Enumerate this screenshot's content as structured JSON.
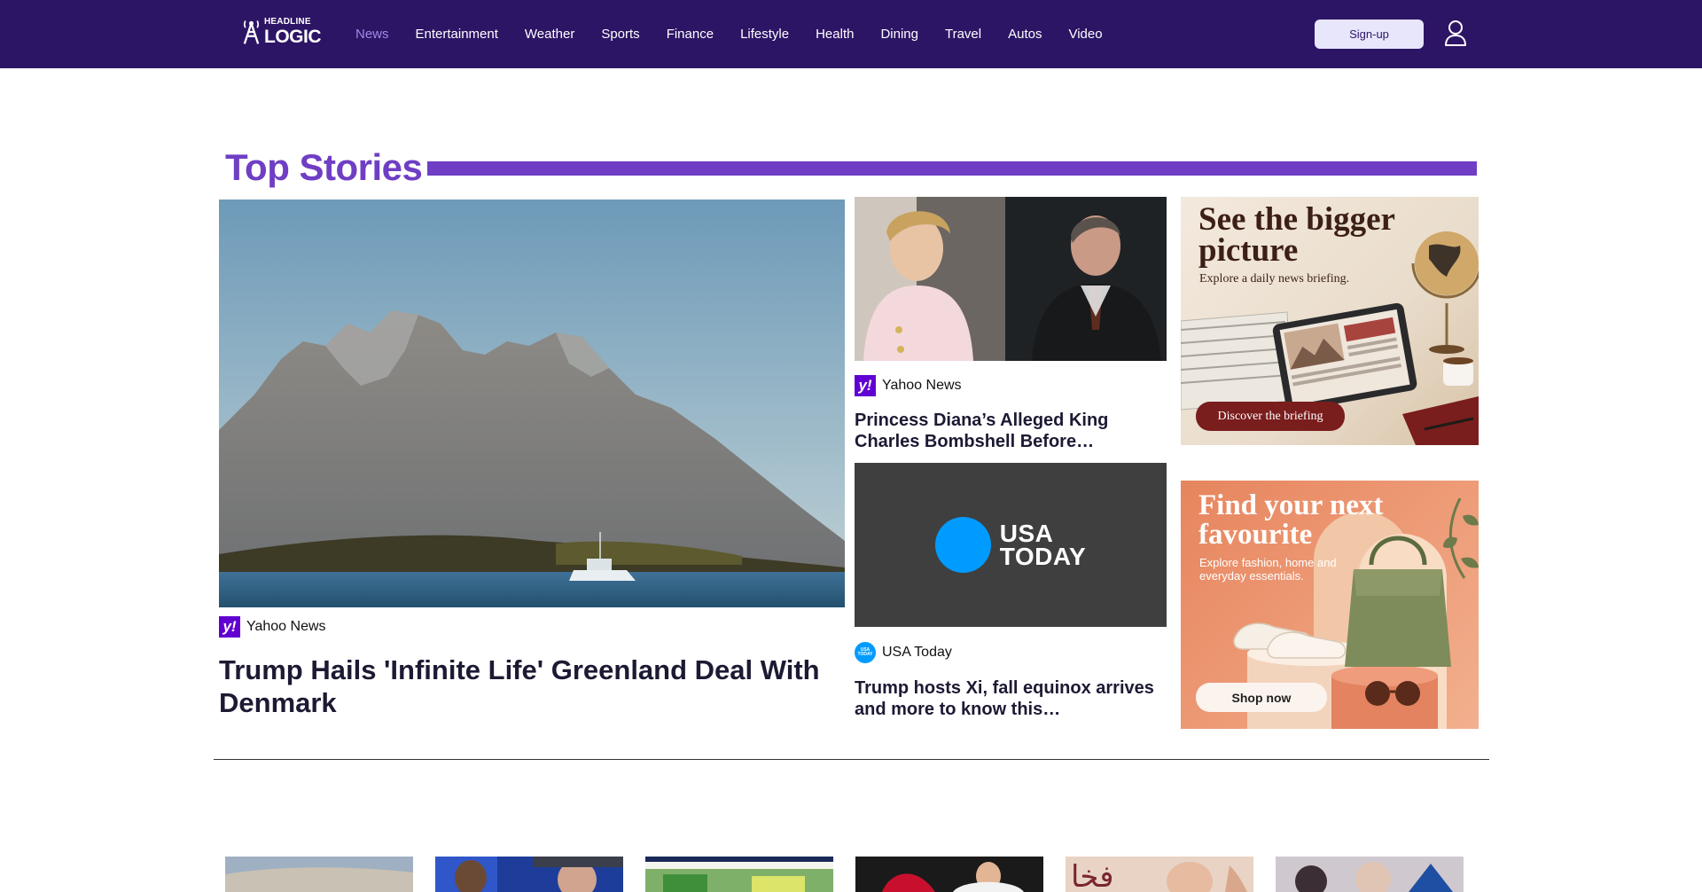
{
  "brand": {
    "logo_line1": "HEADLINE",
    "logo_line2": "LOGIC",
    "nav_bg": "#2d1566",
    "accent": "#6f3ec4"
  },
  "nav": {
    "items": [
      {
        "label": "News",
        "active": true
      },
      {
        "label": "Entertainment"
      },
      {
        "label": "Weather"
      },
      {
        "label": "Sports"
      },
      {
        "label": "Finance"
      },
      {
        "label": "Lifestyle"
      },
      {
        "label": "Health"
      },
      {
        "label": "Dining"
      },
      {
        "label": "Travel"
      },
      {
        "label": "Autos"
      },
      {
        "label": "Video"
      }
    ],
    "signup_label": "Sign-up"
  },
  "top_stories": {
    "title": "Top Stories",
    "hero": {
      "source": "Yahoo News",
      "source_badge": "y!",
      "headline": "Trump Hails 'Infinite Life' Greenland Deal With Denmark"
    },
    "side": [
      {
        "source": "Yahoo News",
        "source_badge": "y!",
        "headline": "Princess Diana’s Alleged King Charles Bombshell Before…"
      },
      {
        "source": "USA Today",
        "source_badge": "USA TODAY",
        "image_wordmark_line1": "USA",
        "image_wordmark_line2": "TODAY",
        "headline": "Trump hosts Xi, fall equinox arrives and more to know this…"
      }
    ]
  },
  "ads": [
    {
      "title": "See the bigger picture",
      "subtitle": "Explore a daily news briefing.",
      "cta": "Discover the briefing"
    },
    {
      "title": "Find your next favourite",
      "subtitle": "Explore fashion, home and everyday essentials.",
      "cta": "Shop now"
    }
  ],
  "thumbnails_count_visible": 6
}
